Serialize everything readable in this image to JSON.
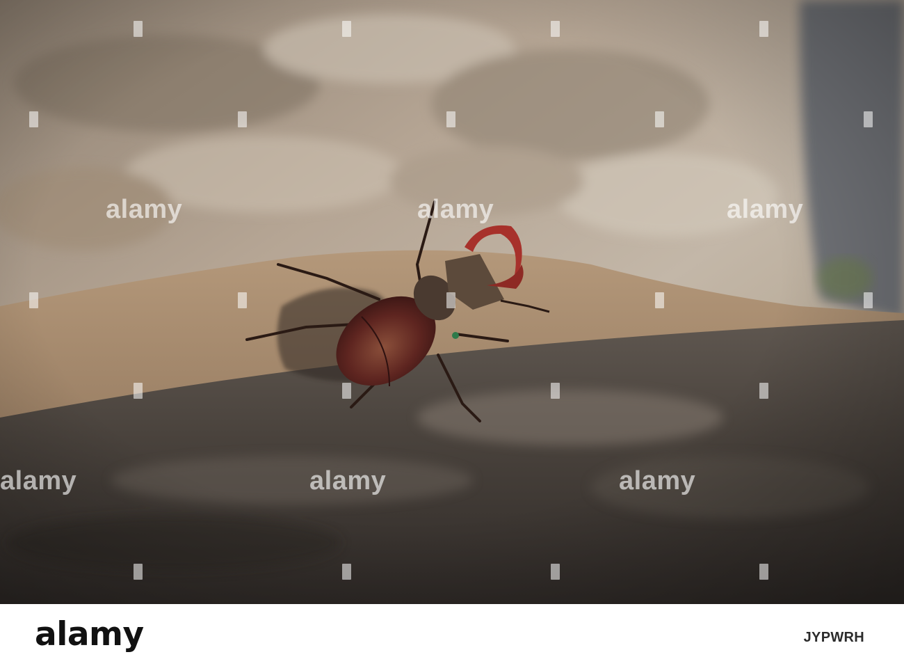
{
  "photo": {
    "subject": "stag-beetle",
    "palette": {
      "rock_light": "#bfb2a2",
      "rock_warm": "#a88e72",
      "ground_shadow": "#3c3632",
      "beetle_body": "#6a2a22",
      "mandible": "#b8322e",
      "background_gray": "#7a7c7f"
    }
  },
  "watermarks": [
    "alamy",
    "alamy",
    "alamy",
    "alamy",
    "alamy",
    "alamy",
    "alamy",
    "alamy",
    "alamy",
    "alamy",
    "alamy",
    "alamy"
  ],
  "footer": {
    "logo": "alamy",
    "image_id": "JYPWRH"
  }
}
